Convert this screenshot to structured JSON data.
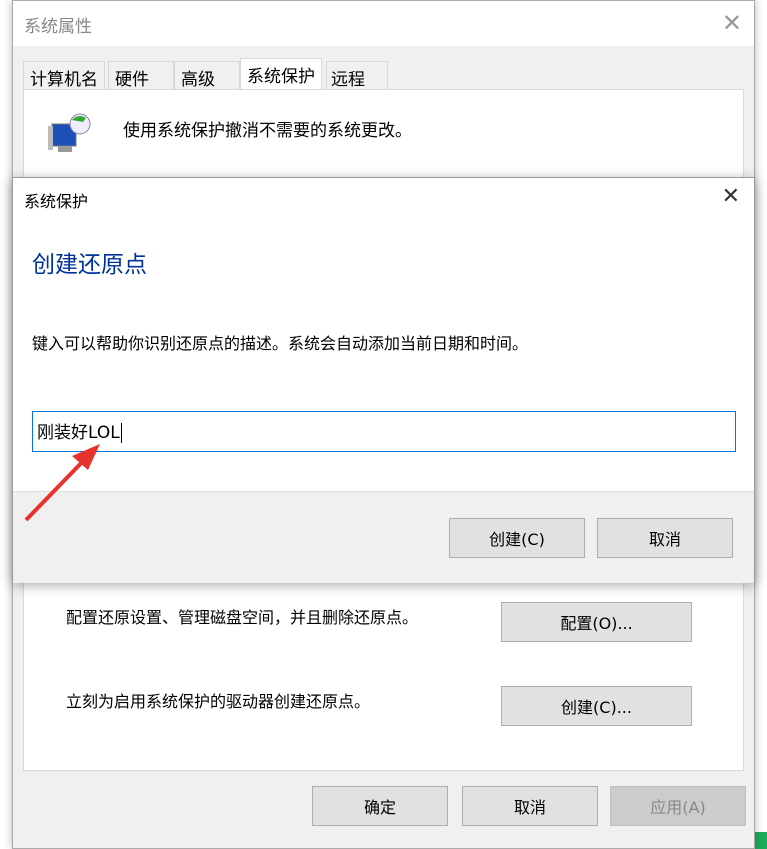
{
  "outer": {
    "title": "系统属性",
    "tabs": [
      "计算机名",
      "硬件",
      "高级",
      "系统保护",
      "远程"
    ],
    "active_tab": 3,
    "intro": "使用系统保护撤消不需要的系统更改。",
    "configure_text": "配置还原设置、管理磁盘空间，并且删除还原点。",
    "configure_button": "配置(O)...",
    "create_text": "立刻为启用系统保护的驱动器创建还原点。",
    "create_button": "创建(C)...",
    "ok": "确定",
    "cancel": "取消",
    "apply": "应用(A)"
  },
  "dialog": {
    "title": "系统保护",
    "heading": "创建还原点",
    "description": "键入可以帮助你识别还原点的描述。系统会自动添加当前日期和时间。",
    "input_value": "刚装好LOL",
    "create": "创建(C)",
    "cancel": "取消"
  },
  "colors": {
    "heading": "#003399",
    "focus": "#0078d7",
    "arrow": "#e8322d"
  }
}
